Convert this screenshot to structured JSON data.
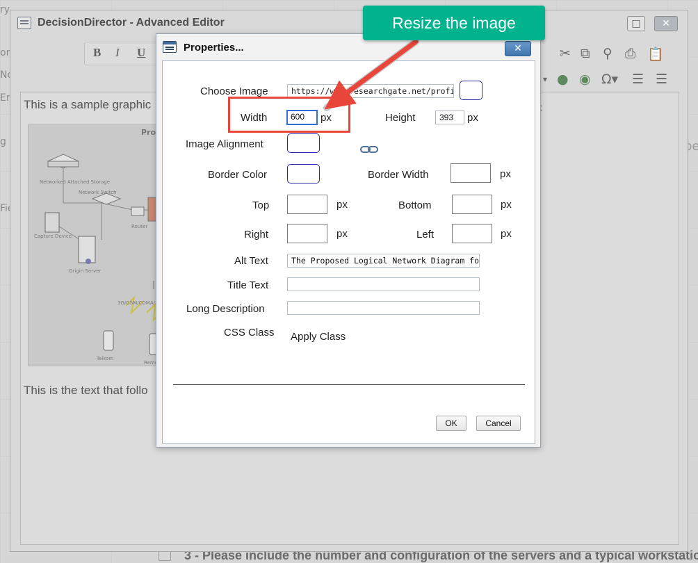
{
  "background": {
    "left_labels": [
      "ry",
      "ort/",
      "No",
      "Env",
      "g Int",
      "Fiel"
    ],
    "bottom_text": "3 - Please include the number and configuration of the servers and a typical workstation",
    "right_fragment": "pe"
  },
  "editor": {
    "title": "DecisionDirector - Advanced Editor",
    "max_glyph": "□",
    "close_glyph": "✕",
    "format_buttons": [
      "B",
      "I",
      "U"
    ],
    "content": {
      "line1": "This is a sample graphic",
      "line2": "This is the text that follo",
      "colon": ":",
      "diagram": {
        "title": "Prop",
        "labels": {
          "nas": "Networked Attached Storage",
          "switch": "Network Switch",
          "router": "Router",
          "capture": "Capture Device",
          "origin": "Origin Server",
          "network": "3G/GSM/CDMA/",
          "telkom": "Telkom",
          "remote": "Remo"
        }
      }
    }
  },
  "dialog": {
    "title": "Properties...",
    "close_glyph": "✕",
    "fields": {
      "choose_image_label": "Choose Image",
      "choose_image_value": "https://www.researchgate.net/profile/He",
      "width_label": "Width",
      "width_value": "600",
      "height_label": "Height",
      "height_value": "393",
      "px": "px",
      "image_alignment_label": "Image Alignment",
      "border_color_label": "Border Color",
      "border_width_label": "Border Width",
      "top_label": "Top",
      "bottom_label": "Bottom",
      "right_label": "Right",
      "left_label": "Left",
      "alt_text_label": "Alt Text",
      "alt_text_value": "The Proposed Logical Network Diagram for the C",
      "title_text_label": "Title Text",
      "title_text_value": "",
      "long_description_label": "Long Description",
      "long_description_value": "",
      "css_class_label": "CSS Class",
      "css_class_value": "Apply Class"
    },
    "buttons": {
      "ok": "OK",
      "cancel": "Cancel"
    }
  },
  "annotation": {
    "callout_text": "Resize the image",
    "color_callout": "#00b38f",
    "color_highlight": "#e8463a"
  }
}
